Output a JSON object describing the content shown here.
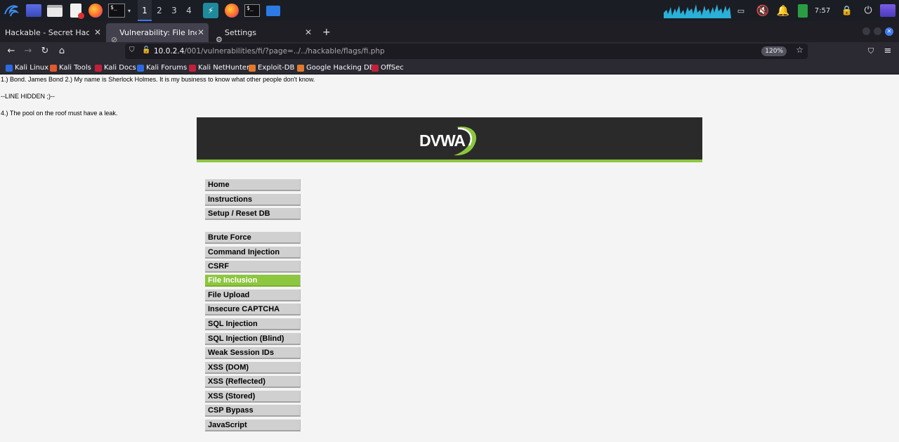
{
  "taskbar": {
    "workspaces": [
      "1",
      "2",
      "3",
      "4"
    ],
    "active_workspace": "1",
    "clock": "7:57",
    "icons": [
      "kali-dragon-icon",
      "desktop-icon",
      "file-manager-icon",
      "text-editor-icon",
      "firefox-icon",
      "terminal-icon",
      "chevron-down-icon",
      "app-icon",
      "firefox-icon",
      "terminal-icon",
      "window-icon"
    ]
  },
  "browser": {
    "tabs": [
      {
        "title": "Hackable - Secret Hacker",
        "active": false
      },
      {
        "title": "Vulnerability: File Inclusio",
        "active": true
      },
      {
        "title": "Settings",
        "active": false
      }
    ],
    "new_tab_label": "+",
    "url_host": "10.0.2.4",
    "url_path": "/001/vulnerabilities/fi/?page=../../hackable/flags/fi.php",
    "zoom": "120%",
    "bookmarks": [
      {
        "label": "Kali Linux",
        "color": "#2d6ae0"
      },
      {
        "label": "Kali Tools",
        "color": "#e05a2d"
      },
      {
        "label": "Kali Docs",
        "color": "#c2203a"
      },
      {
        "label": "Kali Forums",
        "color": "#2d6ae0"
      },
      {
        "label": "Kali NetHunter",
        "color": "#c2203a"
      },
      {
        "label": "Exploit-DB",
        "color": "#e07a2d"
      },
      {
        "label": "Google Hacking DB",
        "color": "#e07a2d"
      },
      {
        "label": "OffSec",
        "color": "#c2203a"
      }
    ]
  },
  "page": {
    "leaked_lines": [
      "1.) Bond. James Bond 2.) My name is Sherlock Holmes. It is my business to know what other people don't know.",
      "--LINE HIDDEN ;)--",
      "4.) The pool on the roof must have a leak."
    ],
    "logo_text": "DVWA",
    "menu_top": [
      "Home",
      "Instructions",
      "Setup / Reset DB"
    ],
    "menu_vulns": [
      "Brute Force",
      "Command Injection",
      "CSRF",
      "File Inclusion",
      "File Upload",
      "Insecure CAPTCHA",
      "SQL Injection",
      "SQL Injection (Blind)",
      "Weak Session IDs",
      "XSS (DOM)",
      "XSS (Reflected)",
      "XSS (Stored)",
      "CSP Bypass",
      "JavaScript"
    ],
    "selected_menu": "File Inclusion"
  },
  "colors": {
    "accent": "#8dc63f",
    "header_bg": "#2a2a2a",
    "page_bg": "#f4f4f4"
  }
}
